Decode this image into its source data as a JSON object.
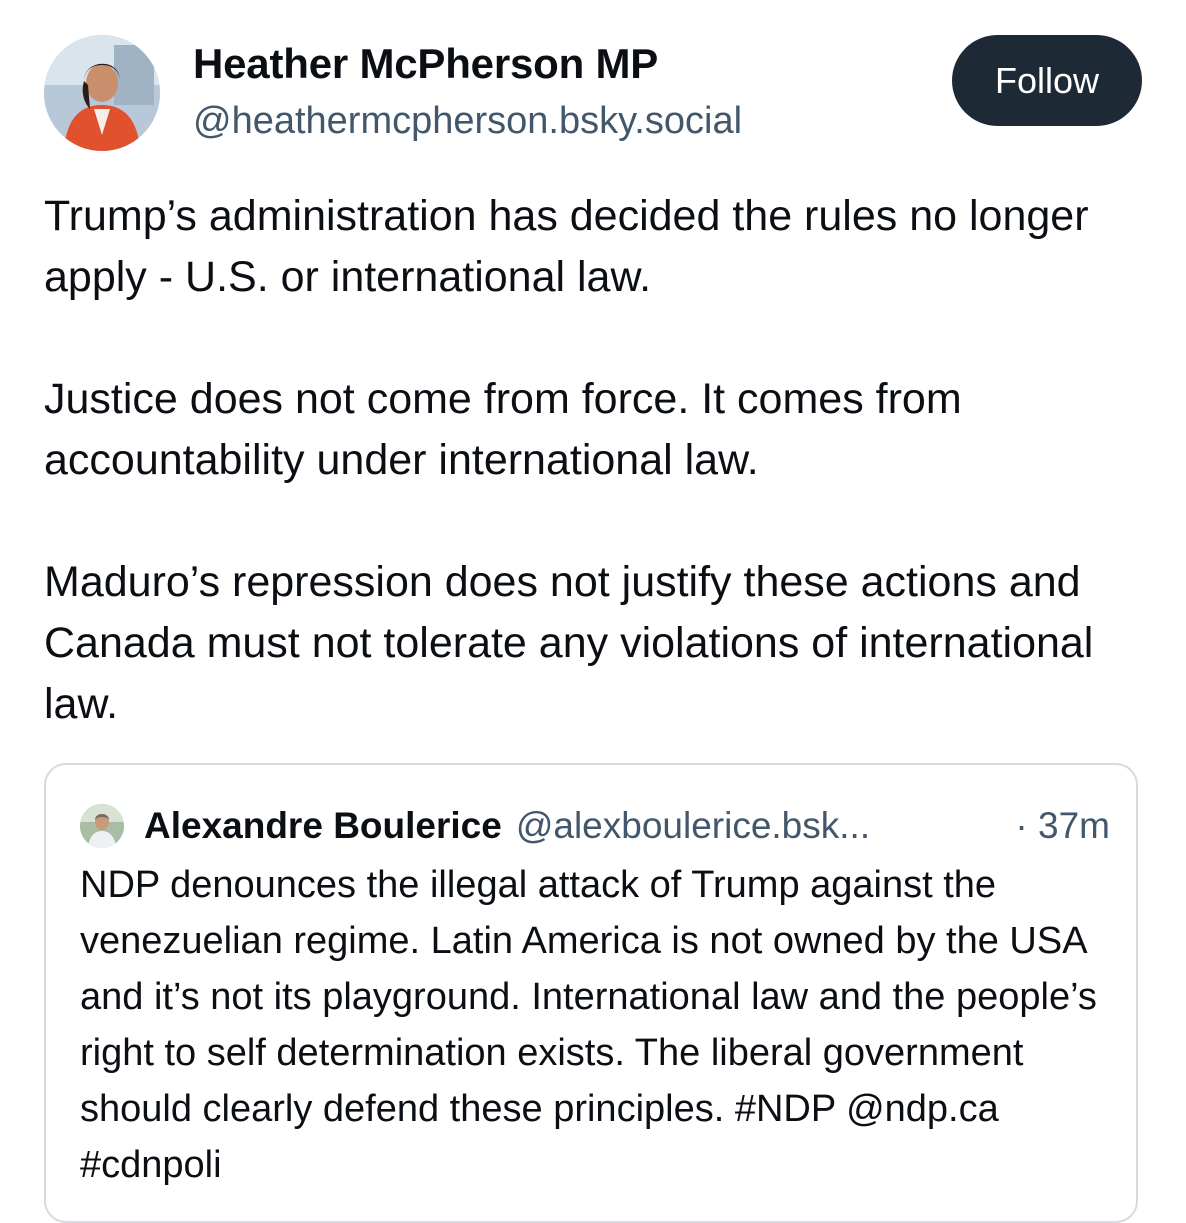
{
  "author": {
    "display_name": "Heather McPherson MP",
    "handle": "@heathermcpherson.bsky.social",
    "follow_label": "Follow"
  },
  "post": {
    "paragraphs": [
      "Trump’s administration has decided the rules no longer apply - U.S. or international law.",
      "Justice does not come from force. It comes from accountability under international law.",
      "Maduro’s repression does not justify these actions and Canada must not tolerate any violations of international law."
    ]
  },
  "quoted_post": {
    "display_name": "Alexandre Boulerice",
    "handle": "@alexboulerice.bsk...",
    "time": "· 37m",
    "text": "NDP denounces the illegal attack of Trump against the venezuelian regime. Latin America is not owned by the USA and it’s not its playground. International law and the people’s right to self determination exists. The liberal government should clearly defend these principles. #NDP @ndp.ca #cdnpoli"
  },
  "colors": {
    "follow_button_bg": "#1e2936",
    "secondary_text": "#42576c",
    "card_border": "#d4dbe2"
  }
}
